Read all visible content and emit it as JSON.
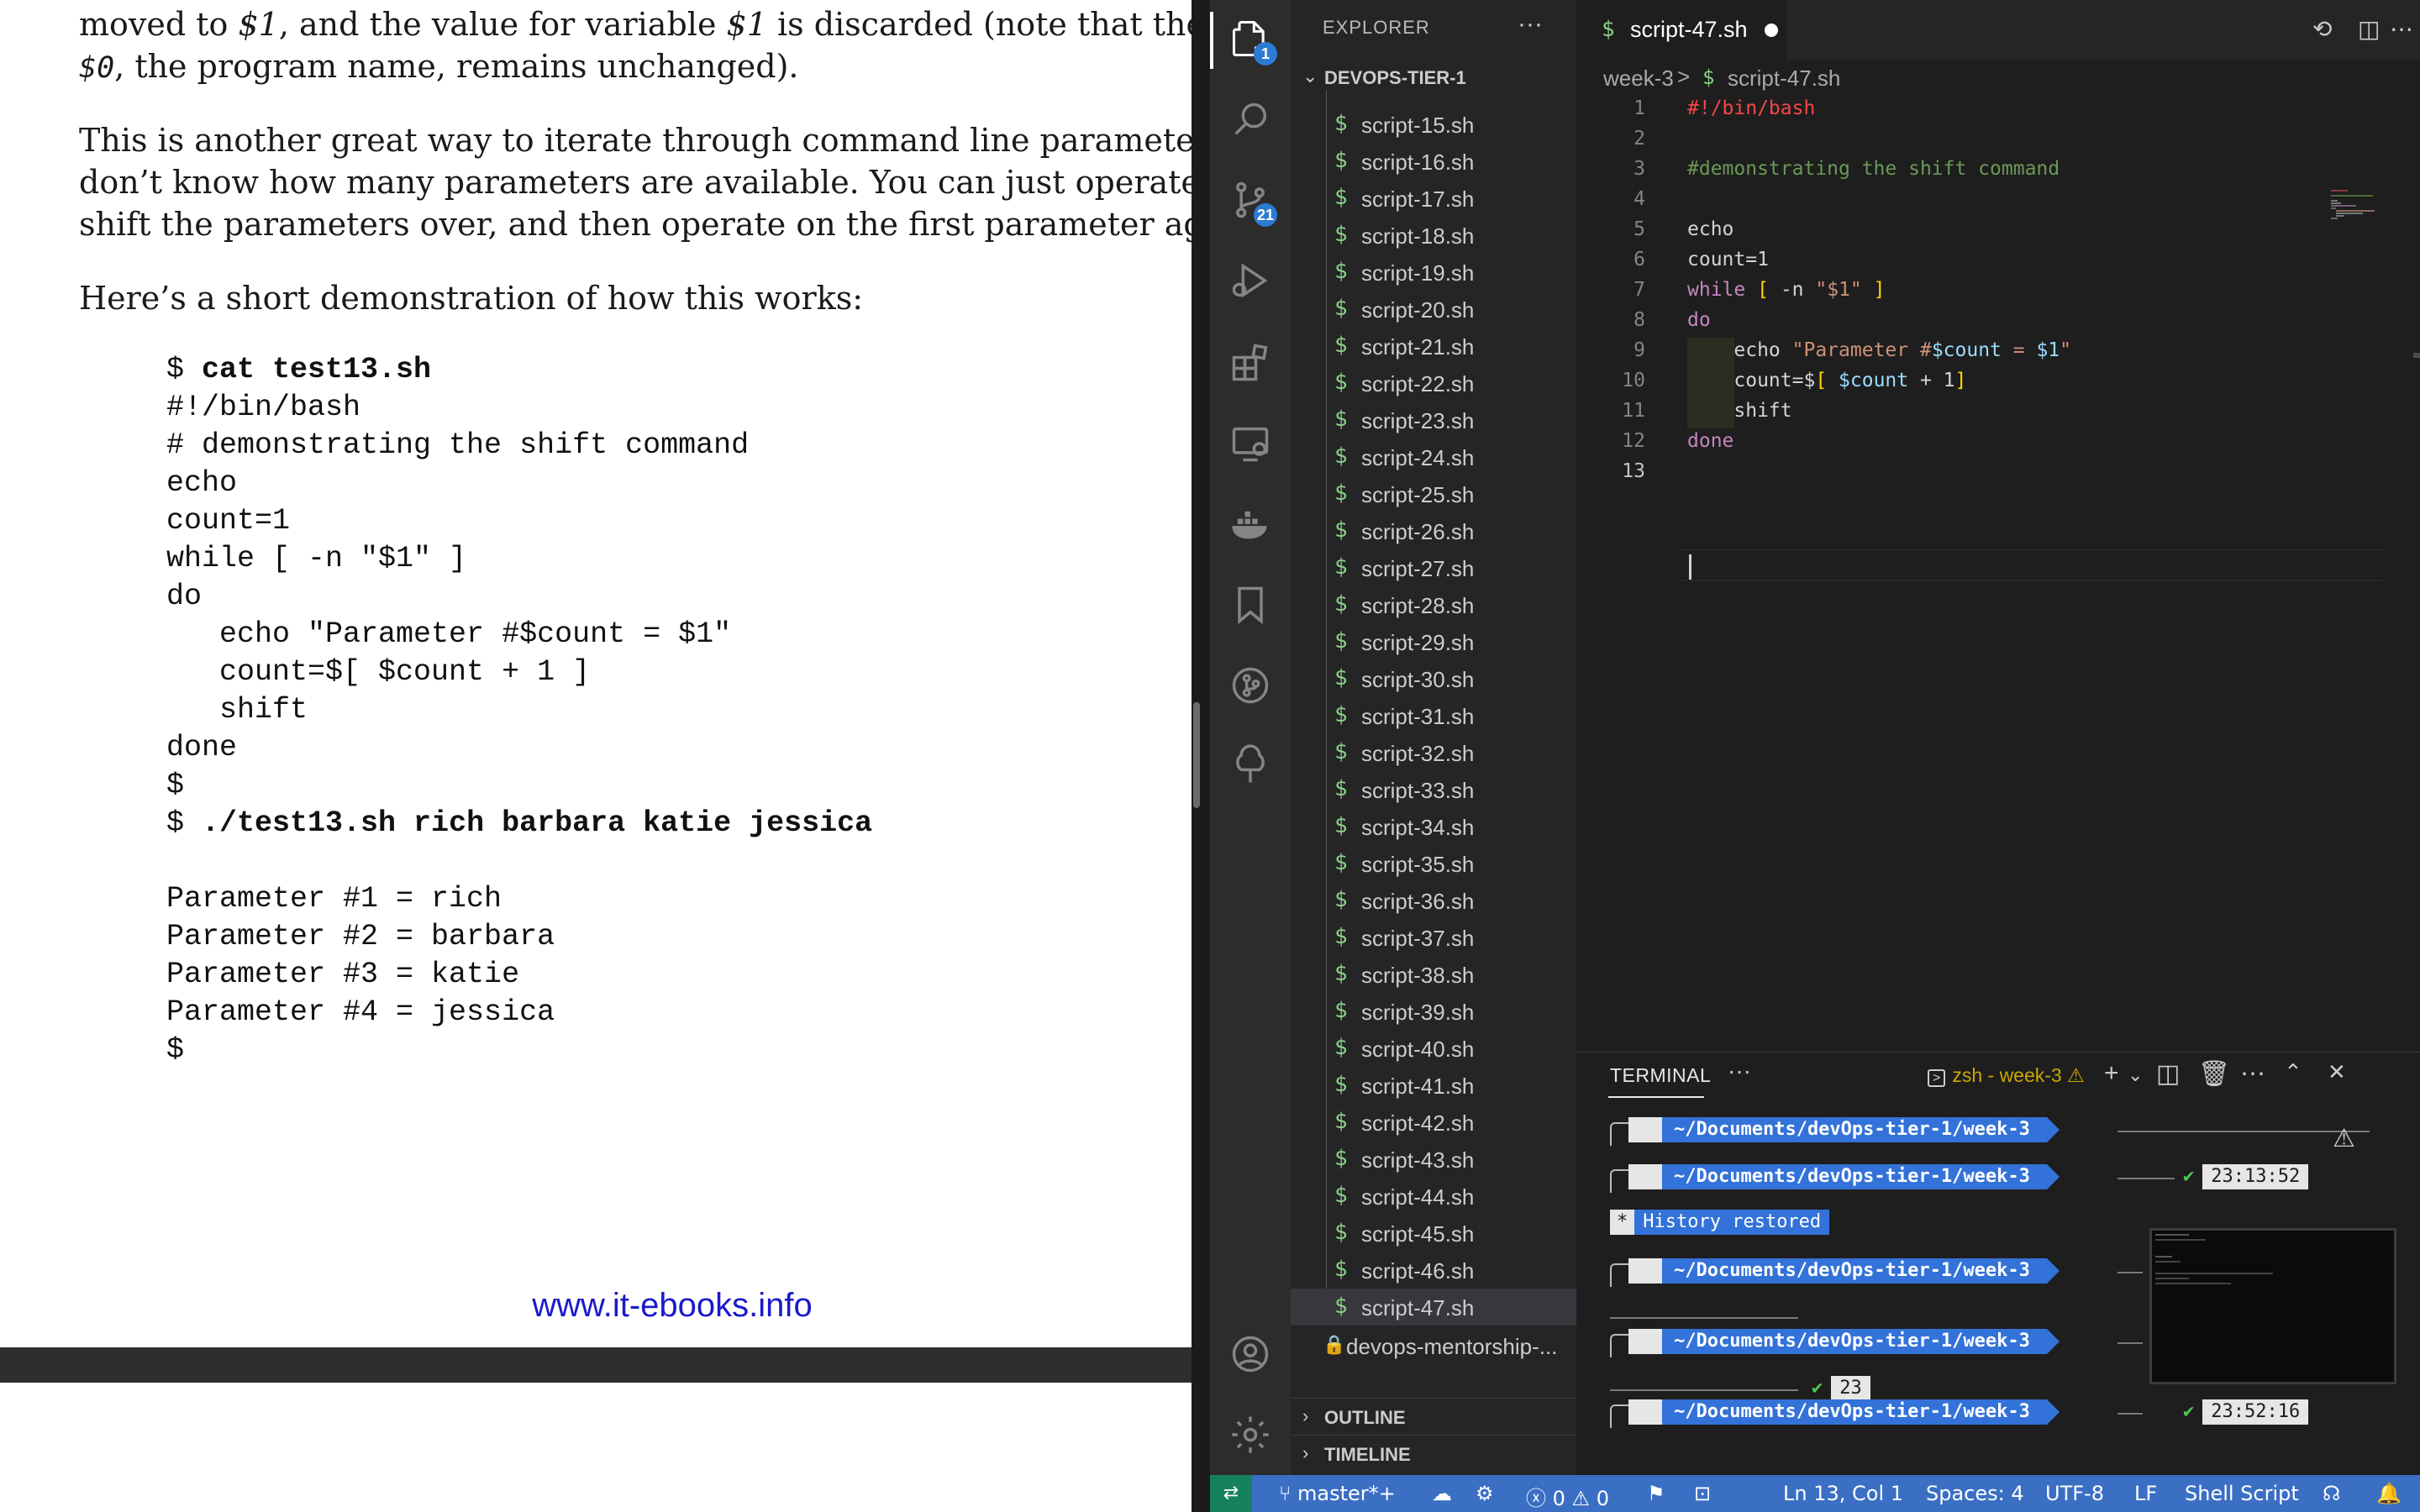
{
  "pdf": {
    "para1": [
      "moved to ",
      "$1",
      ", and the value for variable ",
      "$1",
      " is discarded (note that the valu",
      "$0",
      ", the program name, remains unchanged)."
    ],
    "para2": [
      "This is another great way to iterate through command line parameters, esp",
      "don’t know how many parameters are available. You can just operate on the",
      "shift the parameters over, and then operate on the first parameter again."
    ],
    "para3": "Here’s a short demonstration of how this works:",
    "code": [
      {
        "text": "$ ",
        "bold": "cat test13.sh"
      },
      {
        "text": "#!/bin/bash"
      },
      {
        "text": "# demonstrating the shift command"
      },
      {
        "text": "echo"
      },
      {
        "text": "count=1"
      },
      {
        "text": "while [ -n \"$1\" ]"
      },
      {
        "text": "do"
      },
      {
        "text": "   echo \"Parameter #$count = $1\""
      },
      {
        "text": "   count=$[ $count + 1 ]"
      },
      {
        "text": "   shift"
      },
      {
        "text": "done"
      },
      {
        "text": "$"
      },
      {
        "text": "$ ",
        "bold": "./test13.sh rich barbara katie jessica"
      },
      {
        "text": ""
      },
      {
        "text": "Parameter #1 = rich"
      },
      {
        "text": "Parameter #2 = barbara"
      },
      {
        "text": "Parameter #3 = katie"
      },
      {
        "text": "Parameter #4 = jessica"
      },
      {
        "text": "$"
      }
    ],
    "footer_link": "www.it-ebooks.info"
  },
  "activity_bar": {
    "explorer_badge": "1",
    "scm_badge": "21",
    "icons": [
      "files-icon",
      "search-icon",
      "source-control-icon",
      "run-debug-icon",
      "extensions-icon",
      "remote-explorer-icon",
      "docker-icon",
      "bookmark-icon",
      "git-graph-icon",
      "tree-icon",
      "account-icon",
      "settings-gear-icon"
    ]
  },
  "explorer": {
    "title": "EXPLORER",
    "more": "···",
    "folder": "DEVOPS-TIER-1",
    "files": [
      "script-15.sh",
      "script-16.sh",
      "script-17.sh",
      "script-18.sh",
      "script-19.sh",
      "script-20.sh",
      "script-21.sh",
      "script-22.sh",
      "script-23.sh",
      "script-24.sh",
      "script-25.sh",
      "script-26.sh",
      "script-27.sh",
      "script-28.sh",
      "script-29.sh",
      "script-30.sh",
      "script-31.sh",
      "script-32.sh",
      "script-33.sh",
      "script-34.sh",
      "script-35.sh",
      "script-36.sh",
      "script-37.sh",
      "script-38.sh",
      "script-39.sh",
      "script-40.sh",
      "script-41.sh",
      "script-42.sh",
      "script-43.sh",
      "script-44.sh",
      "script-45.sh",
      "script-46.sh",
      "script-47.sh"
    ],
    "active_file": "script-47.sh",
    "file_icon": "$",
    "git_repo": "devops-mentorship-...",
    "outline": "OUTLINE",
    "timeline": "TIMELINE"
  },
  "editor": {
    "tab_label": "script-47.sh",
    "breadcrumb_folder": "week-3",
    "breadcrumb_sep": ">",
    "breadcrumb_file": "script-47.sh",
    "line_numbers": [
      "1",
      "2",
      "3",
      "4",
      "5",
      "6",
      "7",
      "8",
      "9",
      "10",
      "11",
      "12",
      "13"
    ],
    "current_line": 13,
    "code": {
      "l1": "#!/bin/bash",
      "l3": "#demonstrating the shift command",
      "l5": "echo",
      "l6": "count=1",
      "l7_kw": "while",
      "l7_a": "[",
      "l7_b": " -n ",
      "l7_c": "\"$1\"",
      "l7_d": " ]",
      "l8": "do",
      "l9_a": "echo ",
      "l9_b": "\"Parameter #",
      "l9_c": "$count",
      "l9_d": " = ",
      "l9_e": "$1",
      "l9_f": "\"",
      "l10_a": "count=$",
      "l10_b": "[",
      "l10_c": " $count",
      "l10_d": " + 1",
      "l10_e": "]",
      "l11": "shift",
      "l12": "done"
    }
  },
  "terminal": {
    "title": "TERMINAL",
    "more": "···",
    "shell_name": "zsh - week-3",
    "apple_glyph": "",
    "path": " ~/Documents/devOps-tier-1/week-3",
    "check": "✔",
    "times": [
      "23:13:52",
      "23:52:16"
    ],
    "partial_time": "23",
    "history_star": "*",
    "history_text": "History restored"
  },
  "status_bar": {
    "branch": "master*+",
    "errors": "0",
    "warnings": "0",
    "position": "Ln 13, Col 1",
    "spaces": "Spaces: 4",
    "encoding": "UTF-8",
    "eol": "LF",
    "language": "Shell Script"
  },
  "colors": {
    "statusbar": "#3a6fc4",
    "prompt_blue": "#3372d8",
    "file_icon_green": "#89d185",
    "badge_blue": "#2b7bd4",
    "link_blue": "#1a1acc"
  }
}
